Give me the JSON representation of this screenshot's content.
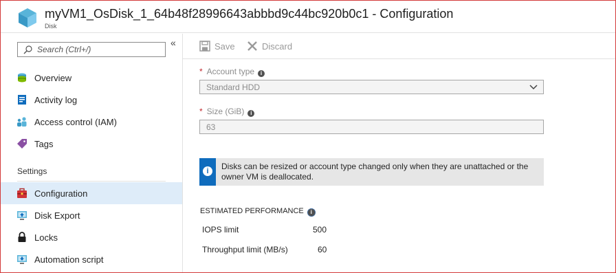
{
  "header": {
    "title": "myVM1_OsDisk_1_64b48f28996643abbbd9c44bc920b0c1 - Configuration",
    "subtitle": "Disk"
  },
  "sidebar": {
    "search_placeholder": "Search (Ctrl+/)",
    "collapse_glyph": "«",
    "items": [
      {
        "label": "Overview",
        "icon": "overview-icon"
      },
      {
        "label": "Activity log",
        "icon": "activity-log-icon"
      },
      {
        "label": "Access control (IAM)",
        "icon": "iam-icon"
      },
      {
        "label": "Tags",
        "icon": "tag-icon"
      }
    ],
    "settings_label": "Settings",
    "settings_items": [
      {
        "label": "Configuration",
        "icon": "toolbox-icon",
        "selected": true
      },
      {
        "label": "Disk Export",
        "icon": "export-icon"
      },
      {
        "label": "Locks",
        "icon": "lock-icon"
      },
      {
        "label": "Automation script",
        "icon": "script-icon"
      }
    ]
  },
  "toolbar": {
    "save_label": "Save",
    "discard_label": "Discard"
  },
  "form": {
    "account_type_label": "Account type",
    "account_type_value": "Standard HDD",
    "size_label": "Size (GiB)",
    "size_value": "63",
    "required_mark": "*",
    "info_glyph": "i"
  },
  "notice": {
    "text": "Disks can be resized or account type changed only when they are unattached or the owner VM is deallocated."
  },
  "performance": {
    "heading": "ESTIMATED PERFORMANCE",
    "rows": [
      {
        "label": "IOPS limit",
        "value": "500"
      },
      {
        "label": "Throughput limit (MB/s)",
        "value": "60"
      }
    ]
  },
  "colors": {
    "accent": "#0f6cbd",
    "selected_bg": "#deecf9",
    "required": "#c1272d"
  }
}
